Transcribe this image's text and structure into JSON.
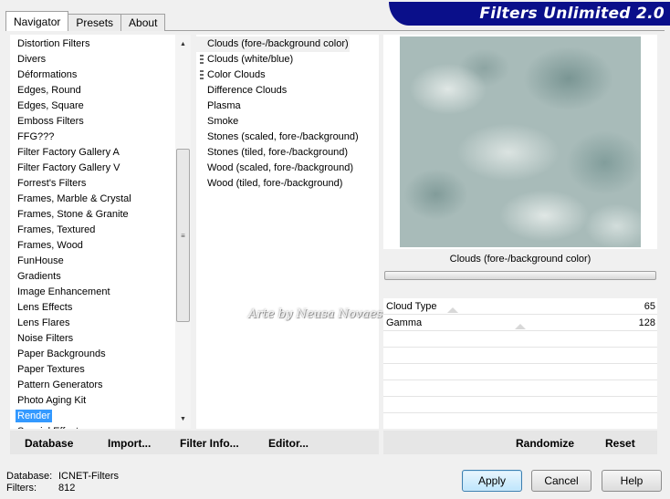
{
  "tabs": [
    {
      "label": "Navigator",
      "active": true
    },
    {
      "label": "Presets",
      "active": false
    },
    {
      "label": "About",
      "active": false
    }
  ],
  "banner": {
    "title": "Filters Unlimited 2.0"
  },
  "categories": {
    "items": [
      "Distortion Filters",
      "Divers",
      "Déformations",
      "Edges, Round",
      "Edges, Square",
      "Emboss Filters",
      "FFG???",
      "Filter Factory Gallery A",
      "Filter Factory Gallery V",
      "Forrest's Filters",
      "Frames, Marble & Crystal",
      "Frames, Stone & Granite",
      "Frames, Textured",
      "Frames, Wood",
      "FunHouse",
      "Gradients",
      "Image Enhancement",
      "Lens Effects",
      "Lens Flares",
      "Noise Filters",
      "Paper Backgrounds",
      "Paper Textures",
      "Pattern Generators",
      "Photo Aging Kit",
      "Render",
      "Special Effects"
    ],
    "selected": "Render"
  },
  "filters": {
    "items": [
      "Clouds (fore-/background color)",
      "Clouds (white/blue)",
      "Color Clouds",
      "Difference Clouds",
      "Plasma",
      "Smoke",
      "Stones (scaled, fore-/background)",
      "Stones (tiled, fore-/background)",
      "Wood (scaled, fore-/background)",
      "Wood (tiled, fore-/background)"
    ],
    "selected": "Clouds (fore-/background color)"
  },
  "preview": {
    "filter_name": "Clouds (fore-/background color)",
    "progress": 0
  },
  "controls": [
    {
      "label": "Cloud Type",
      "value": "65"
    },
    {
      "label": "Gamma",
      "value": "128"
    }
  ],
  "watermark": "Arte by Neusa Novaes",
  "left_toolbar": {
    "database": "Database",
    "import": "Import...",
    "filter_info": "Filter Info...",
    "editor": "Editor..."
  },
  "right_toolbar": {
    "randomize": "Randomize",
    "reset": "Reset"
  },
  "info": {
    "database_label": "Database:",
    "database_value": "ICNET-Filters",
    "filters_label": "Filters:",
    "filters_value": "812"
  },
  "buttons": {
    "apply": "Apply",
    "cancel": "Cancel",
    "help": "Help"
  },
  "colors": {
    "banner": "#0a0f8a",
    "selection": "#3399ff"
  }
}
